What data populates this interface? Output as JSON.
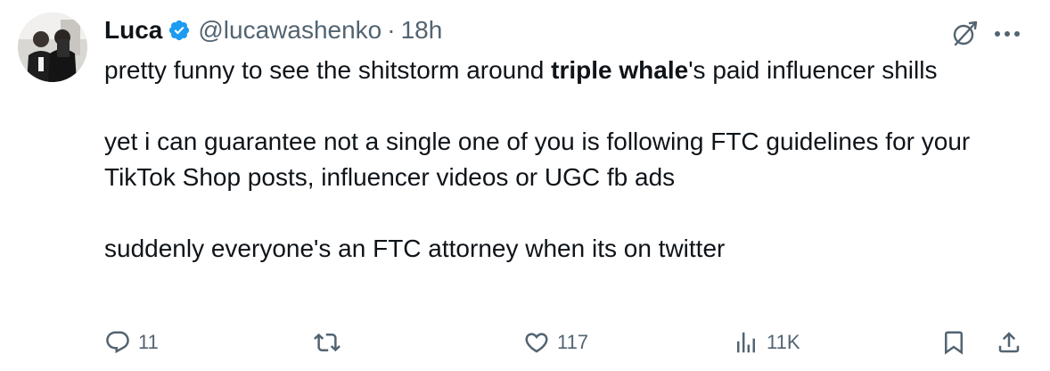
{
  "author": {
    "display_name": "Luca",
    "handle": "@lucawashenko",
    "separator": "·",
    "timestamp": "18h",
    "verified": true
  },
  "tweet": {
    "para1_pre": "pretty funny to see the shitstorm around ",
    "para1_bold": "triple whale",
    "para1_post": "'s paid influencer shills",
    "para2": "yet i can guarantee not a single one of you is following FTC guidelines for your TikTok Shop posts, influencer videos or UGC fb ads",
    "para3": "suddenly everyone's an FTC attorney when its on twitter"
  },
  "actions": {
    "replies": "11",
    "likes": "117",
    "views": "11K"
  },
  "icons": {
    "verified": "verified-badge-icon",
    "grok": "grok-icon",
    "more": "more-dots-icon",
    "reply": "reply-icon",
    "retweet": "retweet-icon",
    "like": "heart-icon",
    "views": "views-chart-icon",
    "bookmark": "bookmark-icon",
    "share": "share-icon"
  },
  "colors": {
    "text": "#0f1419",
    "secondary": "#536471",
    "verified_blue": "#1d9bf0"
  }
}
